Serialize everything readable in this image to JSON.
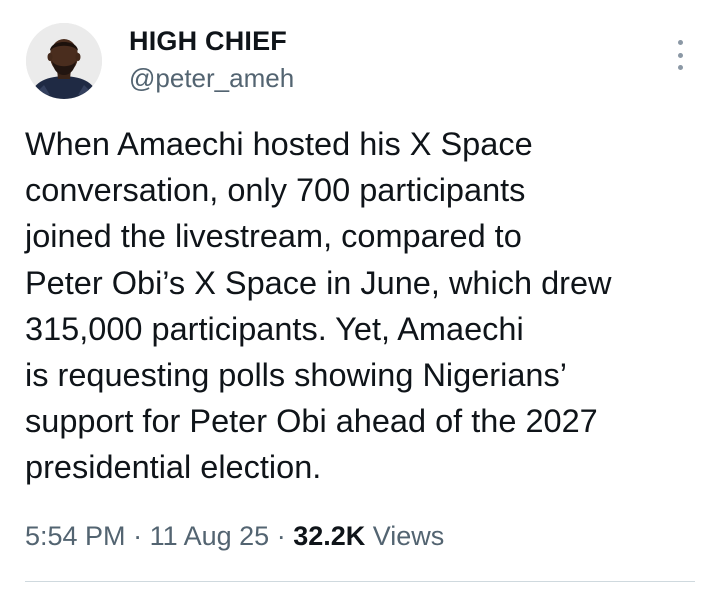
{
  "author": {
    "display_name": "HIGH CHIEF",
    "handle": "@peter_ameh",
    "avatar_icon": "profile-photo"
  },
  "more_icon": "more-vertical-icon",
  "tweet": {
    "lines": [
      "When Amaechi hosted his X Space",
      "conversation, only 700 participants",
      "joined the livestream, compared to",
      "Peter Obi’s X Space in June, which drew",
      "315,000 participants. Yet, Amaechi",
      "is requesting polls showing Nigerians’",
      "support for Peter Obi ahead of the 2027",
      "presidential election."
    ]
  },
  "meta": {
    "time": "5:54 PM",
    "sep1": " · ",
    "date": "11 Aug 25",
    "sep2": " · ",
    "views_count": "32.2K",
    "views_label": " Views"
  },
  "colors": {
    "text": "#0f1419",
    "secondary": "#536471",
    "divider": "#cfd9de"
  }
}
